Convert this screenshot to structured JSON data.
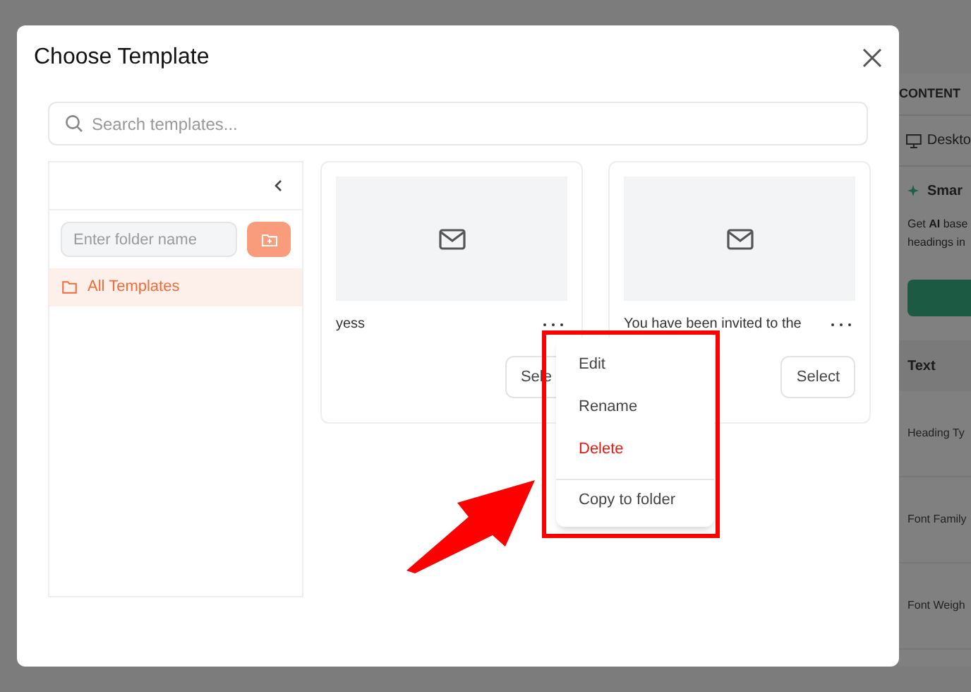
{
  "background_panel": {
    "section_title": "CONTENT",
    "device": "Deskto",
    "smart_title": "Smar",
    "smart_text_1": "Get **AI** base",
    "smart_text_2": "headings in",
    "text_section": "Text",
    "fields": [
      "Heading Ty",
      "Font Family",
      "Font Weigh"
    ]
  },
  "dialog": {
    "title": "Choose Template",
    "search": {
      "placeholder": "Search templates..."
    },
    "folder_input": {
      "placeholder": "Enter folder name"
    },
    "folders": [
      {
        "label": "All Templates",
        "selected": true
      }
    ],
    "templates": [
      {
        "name": "yess",
        "select_label": "Sele",
        "menu_open": true
      },
      {
        "name": "You have been invited to the",
        "select_label": "Select",
        "menu_open": false
      }
    ],
    "menu": [
      {
        "label": "Edit",
        "kind": "normal"
      },
      {
        "label": "Rename",
        "kind": "normal"
      },
      {
        "label": "Delete",
        "kind": "danger"
      },
      {
        "label": "Copy to folder",
        "kind": "separated"
      }
    ]
  }
}
